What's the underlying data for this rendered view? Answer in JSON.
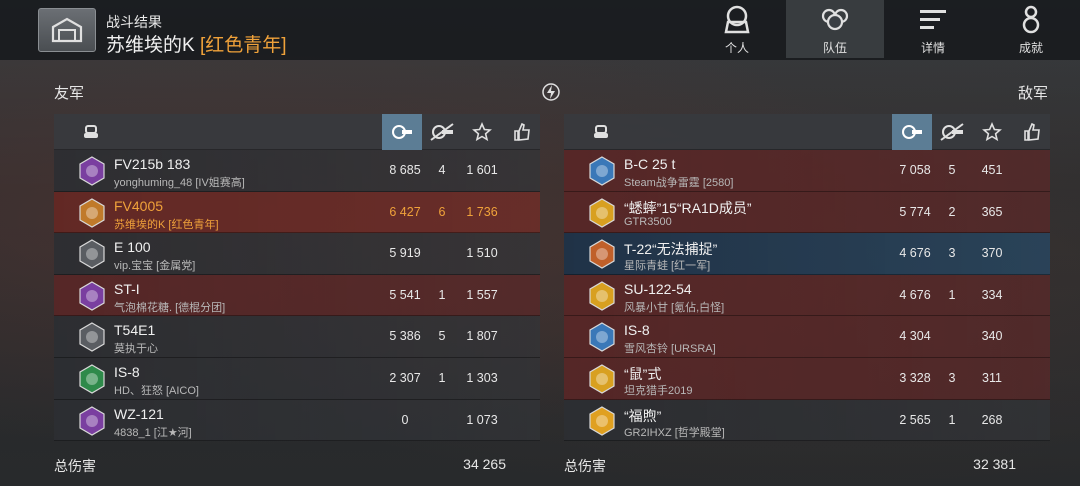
{
  "header": {
    "subtitle": "战斗结果",
    "player_name": "苏维埃的K",
    "player_clan": "[红色青年]"
  },
  "nav": [
    {
      "label": "个人",
      "icon": "helmet-icon"
    },
    {
      "label": "队伍",
      "icon": "team-icon",
      "active": true
    },
    {
      "label": "详情",
      "icon": "list-icon"
    },
    {
      "label": "成就",
      "icon": "medal-icon"
    }
  ],
  "allies": {
    "title": "友军",
    "total_label": "总伤害",
    "total": "34 265",
    "rows": [
      {
        "tank": "FV215b 183",
        "player": "yonghuming_48 [IV姐赛高]",
        "damage": "8 685",
        "kills": "4",
        "exp": "1 601",
        "style": "ally",
        "badge_color": "#7a3fa0"
      },
      {
        "tank": "FV4005",
        "player": "苏维埃的K [红色青年]",
        "damage": "6 427",
        "kills": "6",
        "exp": "1 736",
        "style": "self",
        "badge_color": "#c07a2a"
      },
      {
        "tank": "E 100",
        "player": "vip.宝宝 [金属党]",
        "damage": "5 919",
        "kills": "",
        "exp": "1 510",
        "style": "ally",
        "badge_color": "#5a5d62"
      },
      {
        "tank": "ST-I",
        "player": "气泡棉花糖. [德棍分团]",
        "damage": "5 541",
        "kills": "1",
        "exp": "1 557",
        "style": "enemy",
        "badge_color": "#7a3fa0"
      },
      {
        "tank": "T54E1",
        "player": "莫执于心",
        "damage": "5 386",
        "kills": "5",
        "exp": "1 807",
        "style": "ally",
        "badge_color": "#5a5d62"
      },
      {
        "tank": "IS-8",
        "player": "HD、狂怒 [AICO]",
        "damage": "2 307",
        "kills": "1",
        "exp": "1 303",
        "style": "ally",
        "badge_color": "#2e8a4a"
      },
      {
        "tank": "WZ-121",
        "player": "4838_1 [江★河]",
        "damage": "0",
        "kills": "",
        "exp": "1 073",
        "style": "ally",
        "badge_color": "#7a3fa0"
      }
    ]
  },
  "enemies": {
    "title": "敌军",
    "total_label": "总伤害",
    "total": "32 381",
    "rows": [
      {
        "tank": "B-C 25 t",
        "player": "Steam战争雷霆 [2580]",
        "damage": "7 058",
        "kills": "5",
        "exp": "451",
        "style": "enemy",
        "badge_color": "#3a78b8"
      },
      {
        "tank": "“蟋蟀”15“RA1D成员”",
        "player": "GTR3500",
        "damage": "5 774",
        "kills": "2",
        "exp": "365",
        "style": "enemy",
        "badge_color": "#d8a020"
      },
      {
        "tank": "T-22“无法捕捉”",
        "player": "星际青蛙 [红一军]",
        "damage": "4 676",
        "kills": "3",
        "exp": "370",
        "style": "blue",
        "badge_color": "#c0602a"
      },
      {
        "tank": "SU-122-54",
        "player": "风暴小甘 [氪佔,白怪]",
        "damage": "4 676",
        "kills": "1",
        "exp": "334",
        "style": "enemy",
        "badge_color": "#d8a020"
      },
      {
        "tank": "IS-8",
        "player": "雪风杏铃 [URSRA]",
        "damage": "4 304",
        "kills": "",
        "exp": "340",
        "style": "enemy",
        "badge_color": "#3a78b8"
      },
      {
        "tank": "“鼠”式",
        "player": "坦克猎手2019",
        "damage": "3 328",
        "kills": "3",
        "exp": "311",
        "style": "enemy",
        "badge_color": "#d8a020"
      },
      {
        "tank": "“福煦”",
        "player": "GR2IHXZ [哲学殿堂]",
        "damage": "2 565",
        "kills": "1",
        "exp": "268",
        "style": "ally",
        "badge_color": "#e0a020"
      }
    ]
  },
  "columns": {
    "damage_icon": "damage-icon",
    "kills_icon": "kills-icon",
    "exp_icon": "star-icon",
    "like_icon": "thumbs-up-icon"
  }
}
